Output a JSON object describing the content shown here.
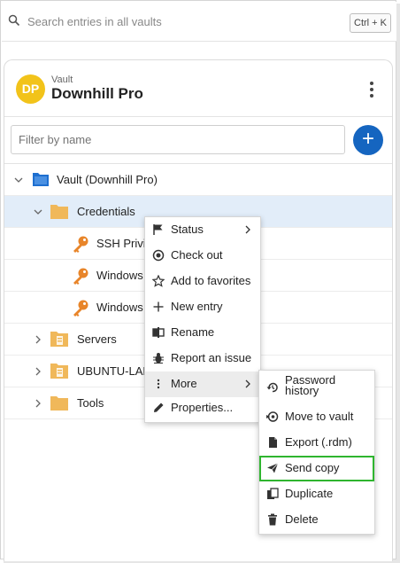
{
  "search": {
    "placeholder": "Search entries in all vaults",
    "shortcut": "Ctrl + K"
  },
  "vault": {
    "avatar": "DP",
    "type_label": "Vault",
    "name": "Downhill Pro"
  },
  "filter": {
    "placeholder": "Filter by name"
  },
  "tree": {
    "root": "Vault (Downhill Pro)",
    "credentials": "Credentials",
    "entries": [
      "SSH Privile",
      "Windows",
      "Windows"
    ],
    "servers": "Servers",
    "ubuntu": "UBUNTU-LAM",
    "tools": "Tools"
  },
  "context_menu": {
    "items": [
      "Status",
      "Check out",
      "Add to favorites",
      "New entry",
      "Rename",
      "Report an issue",
      "More",
      "Properties..."
    ]
  },
  "submenu": {
    "items": [
      "Password history",
      "Move to vault",
      "Export (.rdm)",
      "Send copy",
      "Duplicate",
      "Delete"
    ]
  },
  "colors": {
    "accent": "#1565c0",
    "folder": "#f0b85a",
    "key": "#e8852a",
    "avatar": "#f2c31a",
    "highlight_border": "#2fb52f"
  }
}
